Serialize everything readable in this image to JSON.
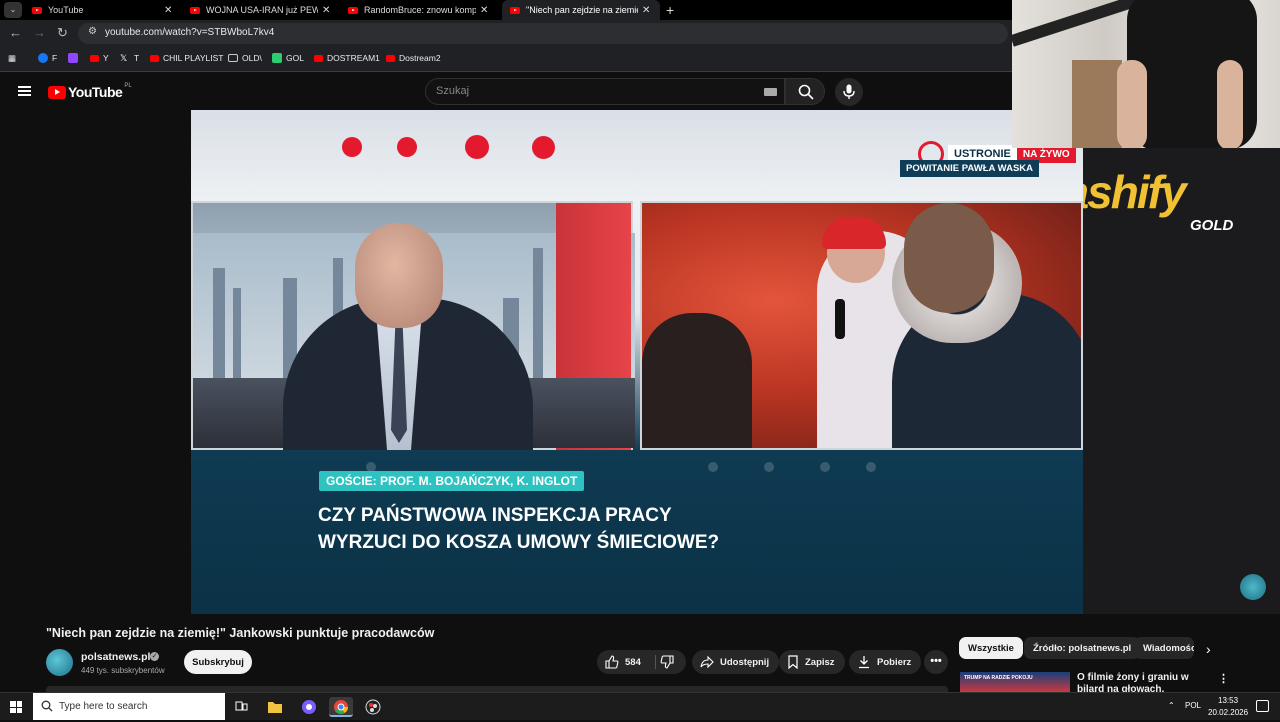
{
  "browser": {
    "tabs": [
      {
        "title": "YouTube",
        "active": false
      },
      {
        "title": "WOJNA USA-IRAN już PEWNA?",
        "active": false
      },
      {
        "title": "RandomBruce: znowu komp do",
        "active": false
      },
      {
        "title": "\"Niech pan zejdzie na ziemię!\" J",
        "active": true
      }
    ],
    "new_tab_icon": "plus-icon",
    "url": "youtube.com/watch?v=STBWboL7kv4",
    "bookmarks": [
      {
        "label": "F",
        "color": "#1877f2"
      },
      {
        "label": "",
        "color": "#9146ff"
      },
      {
        "label": "Y",
        "color": "#ff0000"
      },
      {
        "label": "T",
        "color": "#ffffff"
      },
      {
        "label": "CHIL PLAYLIST",
        "color": "#ff0000"
      },
      {
        "label": "OLD\\",
        "color": "folder"
      },
      {
        "label": "GOL",
        "color": "#2ecc71"
      },
      {
        "label": "DOSTREAM1",
        "color": "#ff0000"
      },
      {
        "label": "Dostream2",
        "color": "#ff0000"
      }
    ]
  },
  "youtube": {
    "logo_text": "YouTube",
    "region": "PL",
    "search_placeholder": "Szukaj"
  },
  "video_frame": {
    "location_label": "USTRONIE",
    "live_label": "NA ŻYWO",
    "strap_label": "POWITANIE PAWŁA WASKA",
    "guests_label": "GOŚCIE: PROF. M. BOJAŃCZYK, K. INGLOT",
    "headline_line1": "CZY PAŃSTWOWA INSPEKCJA PRACY",
    "headline_line2": "WYRZUCI DO KOSZA UMOWY ŚMIECIOWE?",
    "accent_red": "#e3192d",
    "accent_teal": "#2ec3c0"
  },
  "overlay": {
    "sponsor": "cashify",
    "sponsor_sub": "GOLD",
    "sponsor_color": "#f0c233"
  },
  "video_info": {
    "title": "\"Niech pan zejdzie na ziemię!\" Jankowski punktuje pracodawców",
    "channel_name": "polsatnews.pl",
    "subscribers": "449 tys. subskrybentów",
    "subscribe_label": "Subskrybuj",
    "like_count": "584",
    "share_label": "Udostępnij",
    "save_label": "Zapisz",
    "download_label": "Pobierz",
    "more_label": "•••"
  },
  "sidebar": {
    "chips": [
      "Wszystkie",
      "Źródło: polsatnews.pl",
      "Wiadomości"
    ],
    "related": [
      {
        "thumb_text": "TRUMP NA RADZIE POKOJU",
        "title": "O filmie żony i graniu w bilard na głowach. Najdziwniejsze"
      }
    ]
  },
  "taskbar": {
    "search_placeholder": "Type here to search",
    "language": "POL",
    "time": "13:53",
    "date": "20.02.2026"
  }
}
